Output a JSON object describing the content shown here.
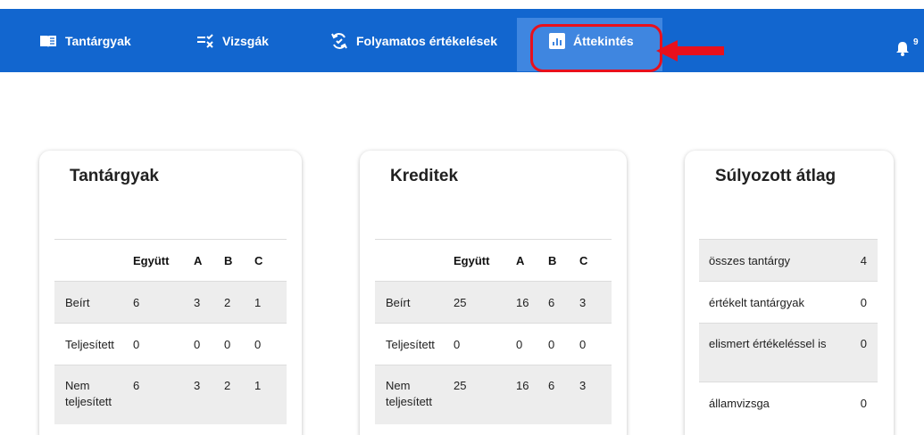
{
  "nav": {
    "items": [
      {
        "label": "Tantárgyak",
        "icon": "book-icon"
      },
      {
        "label": "Vizsgák",
        "icon": "checklist-icon"
      },
      {
        "label": "Folyamatos értékelések",
        "icon": "refresh-check-icon"
      },
      {
        "label": "Áttekintés",
        "icon": "bar-chart-icon"
      }
    ],
    "active": "Áttekintés",
    "notification_count": "9",
    "colors": {
      "bar": "#1266cf",
      "active": "#3f86e0",
      "highlight": "#e8101c"
    }
  },
  "cards": {
    "subjects": {
      "title": "Tantárgyak",
      "headers": [
        "Együtt",
        "A",
        "B",
        "C"
      ],
      "rows": [
        {
          "label": "Beírt",
          "values": [
            "6",
            "3",
            "2",
            "1"
          ]
        },
        {
          "label": "Teljesített",
          "values": [
            "0",
            "0",
            "0",
            "0"
          ]
        },
        {
          "label": "Nem teljesített",
          "values": [
            "6",
            "3",
            "2",
            "1"
          ]
        }
      ]
    },
    "credits": {
      "title": "Kreditek",
      "headers": [
        "Együtt",
        "A",
        "B",
        "C"
      ],
      "rows": [
        {
          "label": "Beírt",
          "values": [
            "25",
            "16",
            "6",
            "3"
          ]
        },
        {
          "label": "Teljesített",
          "values": [
            "0",
            "0",
            "0",
            "0"
          ]
        },
        {
          "label": "Nem teljesített",
          "values": [
            "25",
            "16",
            "6",
            "3"
          ]
        }
      ]
    },
    "weighted": {
      "title": "Súlyozott átlag",
      "rows": [
        {
          "label": "összes tantárgy",
          "value": "4"
        },
        {
          "label": "értékelt tantárgyak",
          "value": "0"
        },
        {
          "label": "elismert értékeléssel is",
          "value": "0"
        },
        {
          "label": "államvizsga",
          "value": "0"
        }
      ]
    }
  }
}
